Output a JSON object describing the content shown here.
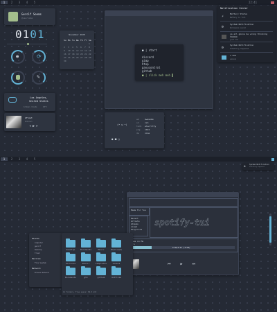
{
  "top_bar": {
    "workspaces": [
      "1",
      "2",
      "3",
      "4",
      "5"
    ],
    "clock": "22:41"
  },
  "bottom_bar": {
    "workspaces": [
      "1",
      "2",
      "3",
      "4",
      "5"
    ]
  },
  "profile": {
    "name": "Gerolf Seems",
    "subtitle": "@username"
  },
  "clock_widget": {
    "hour": "01",
    "minute": "01"
  },
  "calendar": {
    "title": "November 2020",
    "days": [
      "Su",
      "Mo",
      "Tu",
      "We",
      "Th",
      "Fr",
      "Sa"
    ],
    "dates": [
      "",
      "",
      "",
      "",
      "",
      "",
      "1",
      "2",
      "3",
      "4",
      "5",
      "6",
      "7",
      "8",
      "9",
      "10",
      "11",
      "12",
      "13",
      "14",
      "15",
      "16",
      "17",
      "18",
      "19",
      "20",
      "21",
      "22",
      "23",
      "24",
      "25",
      "26",
      "27",
      "28",
      "29",
      "30"
    ]
  },
  "weather": {
    "location": "Los Angeles, United States",
    "detail_left": "broken clouds",
    "detail_right": "18°C"
  },
  "music_small": {
    "title": "Afloat",
    "artist": "Unknown"
  },
  "start_menu": {
    "title": "start",
    "items": [
      "discord",
      "gimp",
      "htop",
      "pavucontrol",
      "github"
    ],
    "prompt": "click meh meh"
  },
  "sysinfo": {
    "face": "(• ω •)",
    "labels": [
      "wm",
      "sh",
      "term",
      "pkg",
      "de"
    ],
    "values": [
      "awesome",
      "zsh",
      "alacritty",
      "1024",
      "none"
    ]
  },
  "notification_center": {
    "title": "Notification Center",
    "items": [
      {
        "title": "Battery Status",
        "body": "Battery is full"
      },
      {
        "title": "System Notification",
        "body": "Workspace saved"
      },
      {
        "title": "ya all gonna be wrong thinking hmmmmm",
        "body": "just now"
      },
      {
        "title": "System Notification",
        "body": "Something happened"
      },
      {
        "title": "u mom",
        "body": "wassup"
      }
    ]
  },
  "toast": {
    "title": "System Notification",
    "body": "Something happened"
  },
  "music_player": {
    "header": "Made For You",
    "sidebar": [
      "Recent",
      "Artists",
      "Albums",
      "Liked",
      "Playlists"
    ],
    "now_playing": "Take on Me",
    "artist": "a-ha",
    "time": "0:40/3:45 (~0:02)",
    "logo": "spotify-tui"
  },
  "file_manager": {
    "sidebar_sections": [
      {
        "title": "Places",
        "items": [
          "Computer",
          "gerolf",
          "Desktop",
          "Trash"
        ]
      },
      {
        "title": "Devices",
        "items": [
          "File System"
        ]
      },
      {
        "title": "Network",
        "items": [
          "Browse Network"
        ]
      }
    ],
    "folders": [
      "Desktop",
      "Documents",
      "Music",
      "Downloads",
      "Pictures",
      "Public",
      "Templates",
      "Videos",
      "Documents",
      "gtk",
      "github",
      "dotfiles"
    ],
    "status": "12 folders, Free space: 89.5 GiB"
  },
  "colors": {
    "accent": "#63b3d6",
    "bg": "#252a35",
    "panel": "#2e3440",
    "green": "#a3be8c"
  }
}
